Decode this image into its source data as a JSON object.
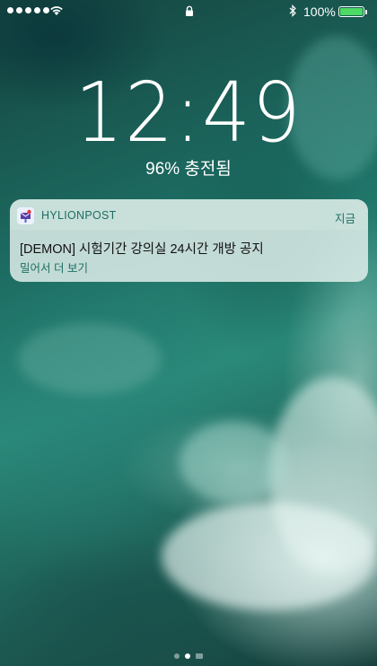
{
  "status_bar": {
    "battery_percent": "100%",
    "signal_bars": 5,
    "battery_color": "#4cd964"
  },
  "lock_screen": {
    "time": "12:49",
    "charging_text": "96% 충전됨"
  },
  "notification": {
    "app_name": "HYLIONPOST",
    "time": "지금",
    "title": "[DEMON] 시험기간 강의실 24시간 개방 공지",
    "action_hint": "밀어서 더 보기",
    "accent_color": "#1e6e62"
  },
  "page_indicator": {
    "pages": 3,
    "active_index": 1
  }
}
